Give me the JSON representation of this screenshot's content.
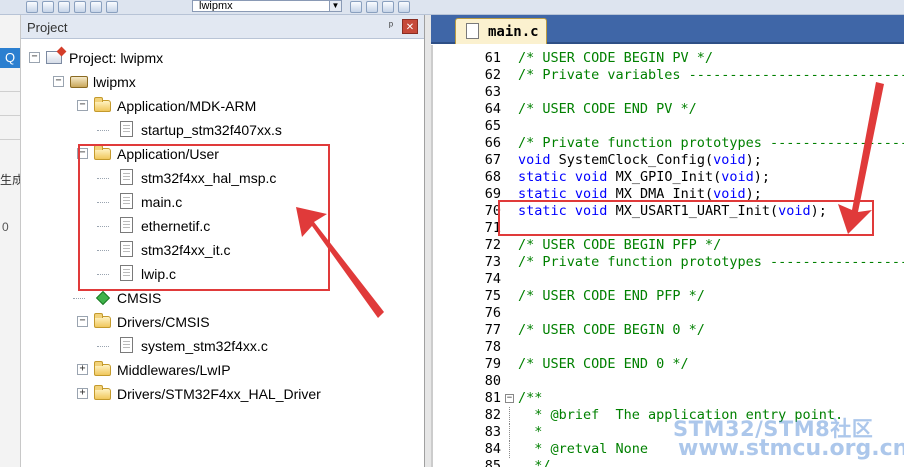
{
  "toolbar": {
    "target_name": "lwipmx"
  },
  "left_strip": {
    "partial_text": "生成",
    "partial_number": "0"
  },
  "project_panel": {
    "title": "Project",
    "pin_glyph": "ᵖ",
    "close_glyph": "×"
  },
  "tree": {
    "root": "Project: lwipmx",
    "target": "lwipmx",
    "groups": [
      {
        "label": "Application/MDK-ARM",
        "files": [
          "startup_stm32f407xx.s"
        ]
      },
      {
        "label": "Application/User",
        "files": [
          "stm32f4xx_hal_msp.c",
          "main.c",
          "ethernetif.c",
          "stm32f4xx_it.c",
          "lwip.c"
        ]
      },
      {
        "label": "CMSIS",
        "files": []
      },
      {
        "label": "Drivers/CMSIS",
        "files": [
          "system_stm32f4xx.c"
        ]
      },
      {
        "label": "Middlewares/LwIP",
        "files": []
      },
      {
        "label": "Drivers/STM32F4xx_HAL_Driver",
        "files": []
      }
    ]
  },
  "editor": {
    "active_tab": "main.c",
    "lines": [
      {
        "n": "61",
        "parts": [
          [
            "cmt",
            "/* USER CODE BEGIN PV */"
          ]
        ]
      },
      {
        "n": "62",
        "parts": [
          [
            "cmt",
            "/* Private variables ----------------------------"
          ]
        ]
      },
      {
        "n": "63",
        "parts": []
      },
      {
        "n": "64",
        "parts": [
          [
            "cmt",
            "/* USER CODE END PV */"
          ]
        ]
      },
      {
        "n": "65",
        "parts": []
      },
      {
        "n": "66",
        "parts": [
          [
            "cmt",
            "/* Private function prototypes ------------------"
          ]
        ]
      },
      {
        "n": "67",
        "parts": [
          [
            "kw",
            "void"
          ],
          [
            "txt",
            " SystemClock_Config("
          ],
          [
            "kw",
            "void"
          ],
          [
            "txt",
            ");"
          ]
        ]
      },
      {
        "n": "68",
        "parts": [
          [
            "kw",
            "static"
          ],
          [
            "txt",
            " "
          ],
          [
            "kw",
            "void"
          ],
          [
            "txt",
            " MX_GPIO_Init("
          ],
          [
            "kw",
            "void"
          ],
          [
            "txt",
            ");"
          ]
        ]
      },
      {
        "n": "69",
        "parts": [
          [
            "kw",
            "static"
          ],
          [
            "txt",
            " "
          ],
          [
            "kw",
            "void"
          ],
          [
            "txt",
            " MX_DMA_Init("
          ],
          [
            "kw",
            "void"
          ],
          [
            "txt",
            ");"
          ]
        ]
      },
      {
        "n": "70",
        "parts": [
          [
            "kw",
            "static"
          ],
          [
            "txt",
            " "
          ],
          [
            "kw",
            "void"
          ],
          [
            "txt",
            " MX_USART1_UART_Init("
          ],
          [
            "kw",
            "void"
          ],
          [
            "txt",
            ");"
          ]
        ]
      },
      {
        "n": "71",
        "parts": []
      },
      {
        "n": "72",
        "parts": [
          [
            "cmt",
            "/* USER CODE BEGIN PFP */"
          ]
        ]
      },
      {
        "n": "73",
        "parts": [
          [
            "cmt",
            "/* Private function prototypes ------------------"
          ]
        ]
      },
      {
        "n": "74",
        "parts": []
      },
      {
        "n": "75",
        "parts": [
          [
            "cmt",
            "/* USER CODE END PFP */"
          ]
        ]
      },
      {
        "n": "76",
        "parts": []
      },
      {
        "n": "77",
        "parts": [
          [
            "cmt",
            "/* USER CODE BEGIN 0 */"
          ]
        ]
      },
      {
        "n": "78",
        "parts": []
      },
      {
        "n": "79",
        "parts": [
          [
            "cmt",
            "/* USER CODE END 0 */"
          ]
        ]
      },
      {
        "n": "80",
        "parts": []
      },
      {
        "n": "81",
        "parts": [
          [
            "cmt",
            "/**"
          ]
        ]
      },
      {
        "n": "82",
        "parts": [
          [
            "cmt",
            "  * @brief  The application entry point."
          ]
        ]
      },
      {
        "n": "83",
        "parts": [
          [
            "cmt",
            "  *"
          ]
        ]
      },
      {
        "n": "84",
        "parts": [
          [
            "cmt",
            "  * @retval None"
          ]
        ]
      },
      {
        "n": "85",
        "parts": [
          [
            "cmt",
            "  */"
          ]
        ]
      }
    ]
  },
  "watermark": {
    "line1": "STM32/STM8社区",
    "line2": "www.stmcu.org.cn"
  },
  "colors": {
    "comment": "#008000",
    "keyword": "#0000ff",
    "annotation_red": "#e03a3a",
    "tab_bar": "#3f66a7"
  }
}
